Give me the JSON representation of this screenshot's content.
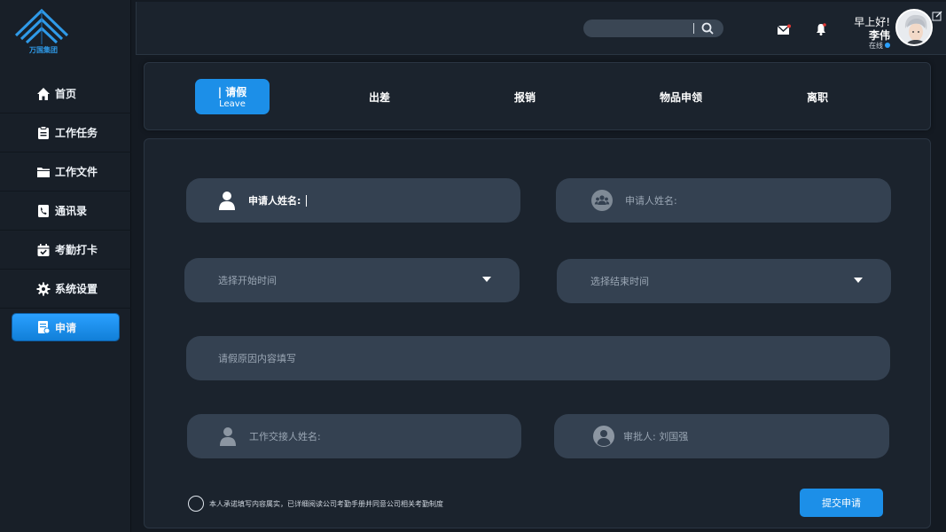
{
  "brand": {
    "name": "万国集团"
  },
  "sidebar": {
    "items": [
      {
        "label": "首页",
        "icon": "home-icon"
      },
      {
        "label": "工作任务",
        "icon": "clipboard-icon"
      },
      {
        "label": "工作文件",
        "icon": "folder-icon"
      },
      {
        "label": "通讯录",
        "icon": "phone-book-icon"
      },
      {
        "label": "考勤打卡",
        "icon": "calendar-check-icon"
      },
      {
        "label": "系统设置",
        "icon": "gear-icon"
      },
      {
        "label": "申请",
        "icon": "form-icon",
        "active": true
      }
    ]
  },
  "header": {
    "search_placeholder": "",
    "greeting": "早上好!",
    "user_name": "李伟",
    "status": "在线"
  },
  "tabs": [
    {
      "label": "| 请假",
      "sub": "Leave",
      "active": true
    },
    {
      "label": "出差"
    },
    {
      "label": "报销"
    },
    {
      "label": "物品申领"
    },
    {
      "label": "离职"
    }
  ],
  "form": {
    "applicant_label": "申请人姓名:",
    "applicant2_placeholder": "申请人姓名:",
    "start_time_placeholder": "选择开始时间",
    "end_time_placeholder": "选择结束时间",
    "reason_placeholder": "请假原因内容填写",
    "handover_placeholder": "工作交接人姓名:",
    "approver_text": "审批人:  刘国强",
    "agreement_text": "本人承诺填写内容属实，已详细阅读公司考勤手册并同意公司相关考勤制度",
    "submit_label": "提交申请"
  },
  "colors": {
    "accent": "#1c8fe8",
    "panel": "#1b232d",
    "field": "#344151",
    "background": "#141a22"
  }
}
